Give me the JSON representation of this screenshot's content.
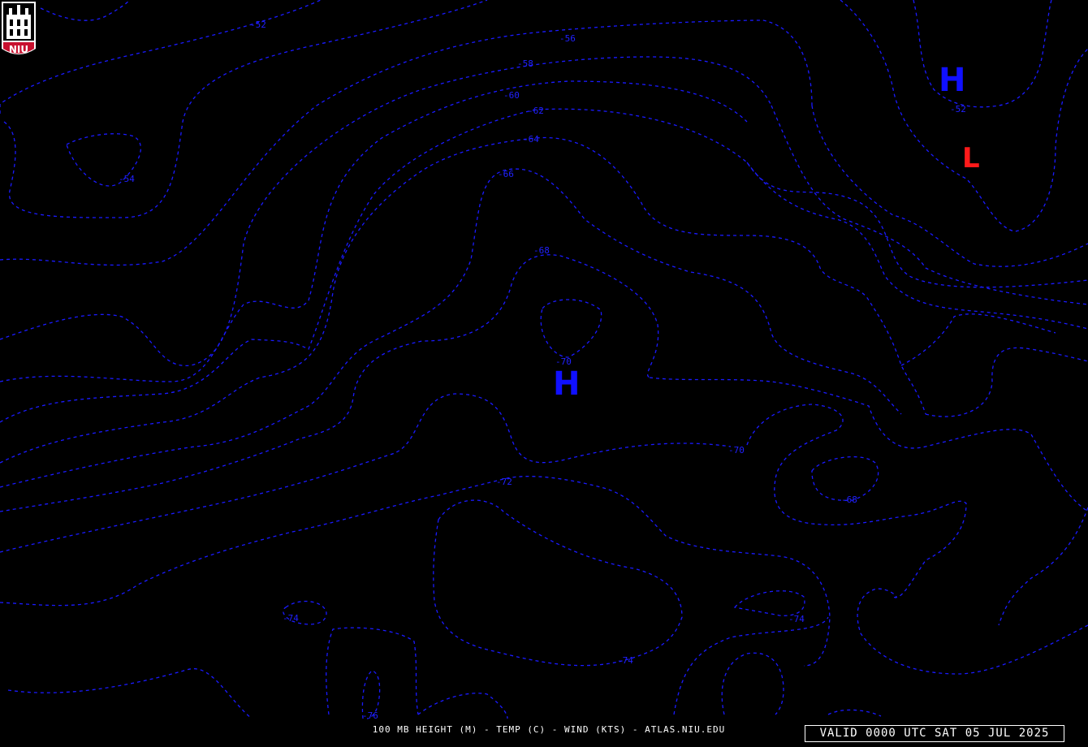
{
  "footer": {
    "title": "100 MB HEIGHT (M) - TEMP (C) - WIND (KTS) - ATLAS.NIU.EDU",
    "valid": "VALID 0000 UTC SAT 05 JUL 2025"
  },
  "logo": {
    "text": "NIU",
    "brand_color": "#c8102e"
  },
  "colors": {
    "background": "#000000",
    "temperature_contour": "#1a1aff",
    "high_center": "#1010ff",
    "low_center": "#ff1a1a",
    "annotation": "#ffffff"
  },
  "pressure_centers": [
    {
      "kind": "high",
      "symbol": "H"
    },
    {
      "kind": "high",
      "symbol": "H"
    },
    {
      "kind": "low",
      "symbol": "L"
    }
  ],
  "contour_labels": [
    "-52",
    "-54",
    "-56",
    "-58",
    "-60",
    "-62",
    "-64",
    "-66",
    "-68",
    "-70",
    "-72",
    "-74",
    "-76"
  ],
  "labels_on_map": [
    "-52",
    "-54",
    "-56",
    "-58",
    "-60",
    "-62",
    "-64",
    "-66",
    "-68",
    "-70",
    "-70",
    "-72",
    "-68",
    "-74",
    "-74",
    "-74",
    "-74",
    "-76",
    "-52"
  ]
}
